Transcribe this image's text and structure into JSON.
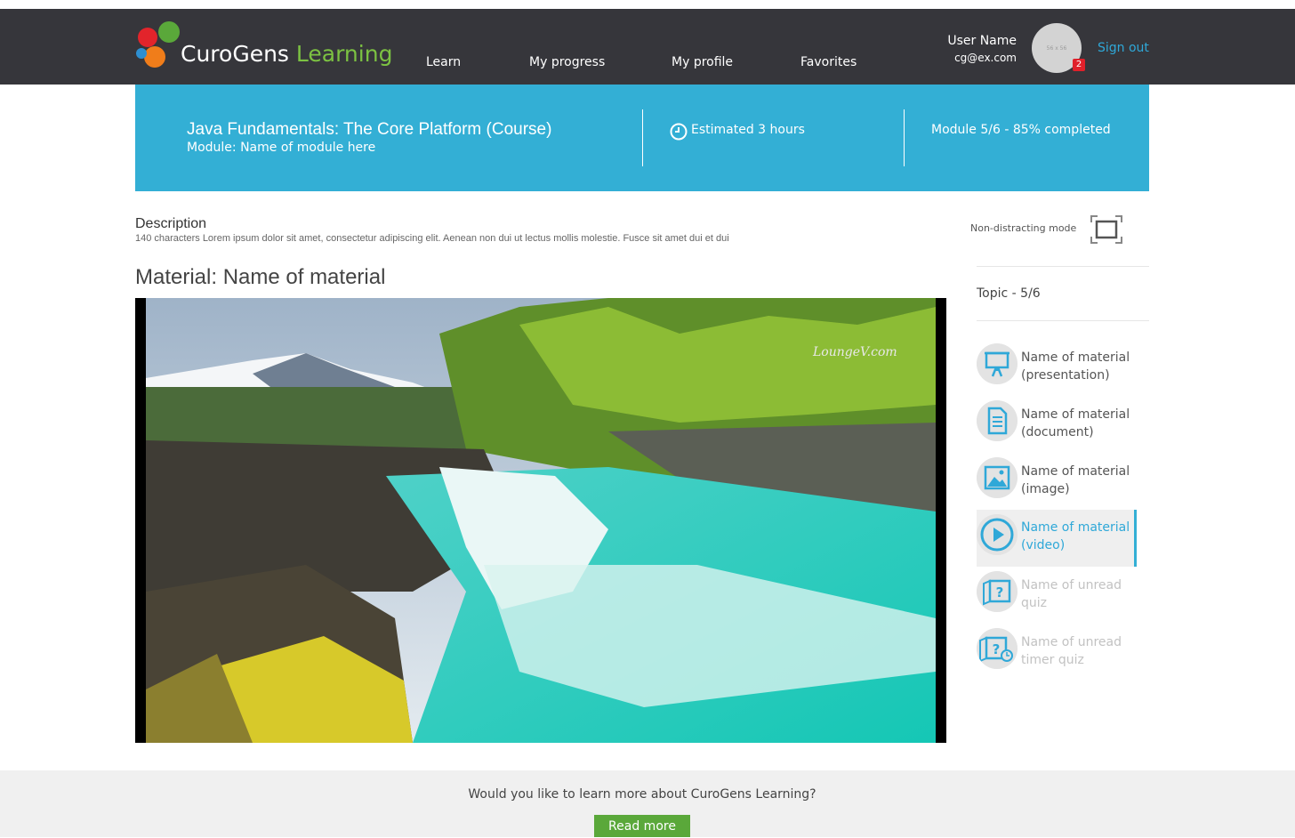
{
  "app": {
    "brand_main": "CuroGens ",
    "brand_accent": "Learning"
  },
  "nav": {
    "items": [
      {
        "label": "Learn"
      },
      {
        "label": "My progress"
      },
      {
        "label": "My profile"
      },
      {
        "label": "Favorites"
      }
    ]
  },
  "user": {
    "name": "User Name",
    "email": "cg@ex.com",
    "avatar_placeholder": "56 x 56",
    "notification_count": "2",
    "sign_out_label": "Sign out"
  },
  "course": {
    "title": "Java Fundamentals: The Core Platform (Course)",
    "module": "Module: Name of module here",
    "estimate": "Estimated 3 hours",
    "progress_text": "Module 5/6 - 85% completed"
  },
  "description": {
    "title": "Description",
    "text": "140 characters Lorem ipsum dolor sit amet, consectetur adipiscing elit. Aenean non dui ut lectus mollis molestie. Fusce sit amet dui et dui"
  },
  "material": {
    "title": "Material: Name of material",
    "watermark": "LoungeV.com"
  },
  "sidebar": {
    "non_distracting_label": "Non-distracting mode",
    "topic": "Topic - 5/6",
    "items": [
      {
        "line1": "Name of material",
        "line2": "(presentation)",
        "icon": "presentation-icon",
        "state": "read"
      },
      {
        "line1": "Name of material",
        "line2": "(document)",
        "icon": "document-icon",
        "state": "read"
      },
      {
        "line1": "Name of material",
        "line2": "(image)",
        "icon": "image-icon",
        "state": "read"
      },
      {
        "line1": "Name of material",
        "line2": "(video)",
        "icon": "video-play-icon",
        "state": "active"
      },
      {
        "line1": "Name of unread",
        "line2": "quiz",
        "icon": "quiz-icon",
        "state": "unread"
      },
      {
        "line1": "Name of unread",
        "line2": "timer quiz",
        "icon": "timer-quiz-icon",
        "state": "unread"
      }
    ]
  },
  "footer": {
    "text": "Would you like to learn more about CuroGens Learning?",
    "button_label": "Read more"
  },
  "colors": {
    "header_bg": "#36363b",
    "banner_bg": "#33afd5",
    "brand_green": "#7cc242",
    "link_blue": "#2fa8d8",
    "button_green": "#5aa83a",
    "badge_red": "#e0202a"
  }
}
